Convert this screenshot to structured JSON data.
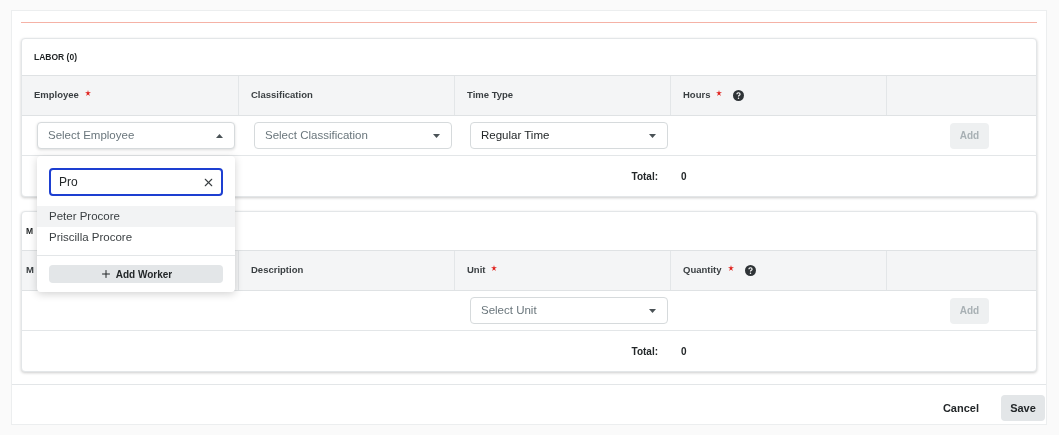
{
  "sections": [
    {
      "title": "LABOR (0)",
      "columns": [
        {
          "label": "Employee",
          "required": true,
          "help": false
        },
        {
          "label": "Classification",
          "required": false,
          "help": false
        },
        {
          "label": "Time Type",
          "required": false,
          "help": false
        },
        {
          "label": "Hours",
          "required": true,
          "help": true
        }
      ],
      "inputs": [
        {
          "kind": "select",
          "placeholder": "Select Employee",
          "open": true
        },
        {
          "kind": "select",
          "placeholder": "Select Classification",
          "open": false
        },
        {
          "kind": "select",
          "value": "Regular Time",
          "open": false
        },
        {
          "kind": "empty"
        }
      ],
      "add_button": {
        "label": "Add",
        "disabled": true
      },
      "total": {
        "label": "Total:",
        "value": "0"
      }
    },
    {
      "title": "M",
      "columns": [
        {
          "label": "M",
          "required": false,
          "help": false
        },
        {
          "label": "Description",
          "required": false,
          "help": false
        },
        {
          "label": "Unit",
          "required": true,
          "help": false
        },
        {
          "label": "Quantity",
          "required": true,
          "help": true
        }
      ],
      "inputs": [
        {
          "kind": "empty"
        },
        {
          "kind": "empty"
        },
        {
          "kind": "select",
          "placeholder": "Select Unit",
          "open": false
        },
        {
          "kind": "empty"
        }
      ],
      "add_button": {
        "label": "Add",
        "disabled": true
      },
      "total": {
        "label": "Total:",
        "value": "0"
      }
    }
  ],
  "dropdown": {
    "search": {
      "value": "Pro"
    },
    "options": [
      {
        "label": "Peter Procore",
        "selected": true
      },
      {
        "label": "Priscilla Procore",
        "selected": false
      }
    ],
    "add_button": "Add Worker"
  },
  "footer": {
    "cancel": "Cancel",
    "save": "Save"
  }
}
